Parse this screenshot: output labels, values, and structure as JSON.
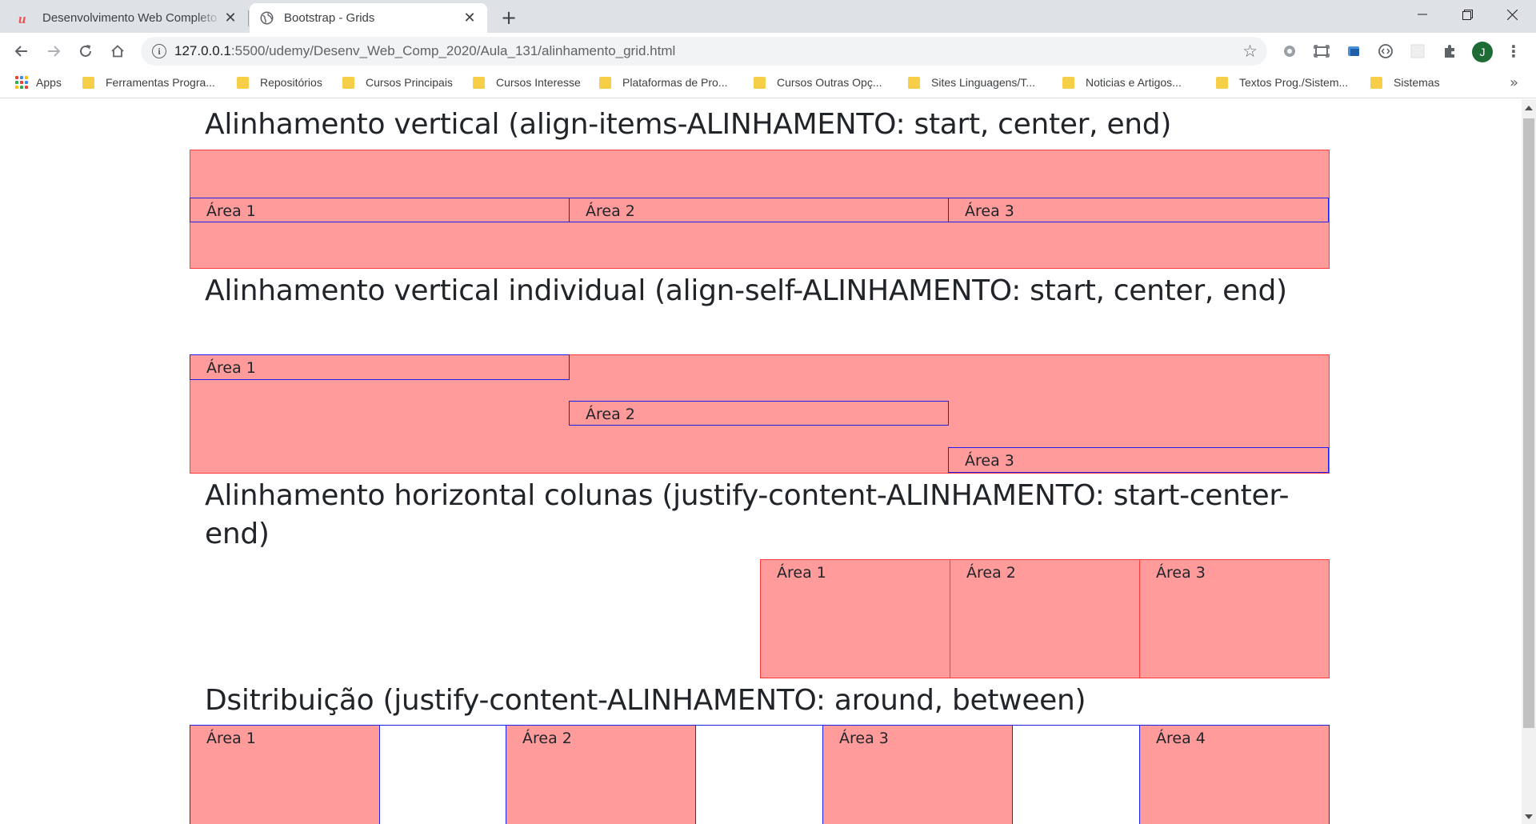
{
  "browser": {
    "tabs": [
      {
        "title": "Desenvolvimento Web Completo",
        "active": false
      },
      {
        "title": "Bootstrap - Grids",
        "active": true
      }
    ],
    "url_host": "127.0.0.1",
    "url_path": ":5500/udemy/Desenv_Web_Comp_2020/Aula_131/alinhamento_grid.html",
    "avatar_letter": "J",
    "bookmarks": [
      "Apps",
      "Ferramentas Progra...",
      "Repositórios",
      "Cursos Principais",
      "Cursos Interesse",
      "Plataformas de Pro...",
      "Cursos Outras Opç...",
      "Sites Linguagens/T...",
      "Noticias e Artigos...",
      "Textos Prog./Sistem...",
      "Sistemas"
    ],
    "colors": {
      "tabbar": "#dee1e6",
      "folder": "#f6ce47",
      "avatar": "#1e6b35",
      "udemy": "#ec5252"
    }
  },
  "page": {
    "sections": [
      {
        "heading": "Alinhamento vertical (align-items-ALINHAMENTO: start, center, end)",
        "areas": [
          "Área 1",
          "Área 2",
          "Área 3"
        ]
      },
      {
        "heading": "Alinhamento vertical individual (align-self-ALINHAMENTO: start, center, end)",
        "areas": [
          "Área 1",
          "Área 2",
          "Área 3"
        ]
      },
      {
        "heading": "Alinhamento horizontal colunas (justify-content-ALINHAMENTO: start-center-end)",
        "areas": [
          "Área 1",
          "Área 2",
          "Área 3"
        ]
      },
      {
        "heading": "Dsitribuição (justify-content-ALINHAMENTO: around, between)",
        "areas": [
          "Área 1",
          "Área 2",
          "Área 3",
          "Área 4"
        ]
      }
    ],
    "colors": {
      "box_fill": "#ff9b9b",
      "box_border": "#ff3b3b",
      "area_border": "#2020ee",
      "text": "#212529"
    }
  }
}
